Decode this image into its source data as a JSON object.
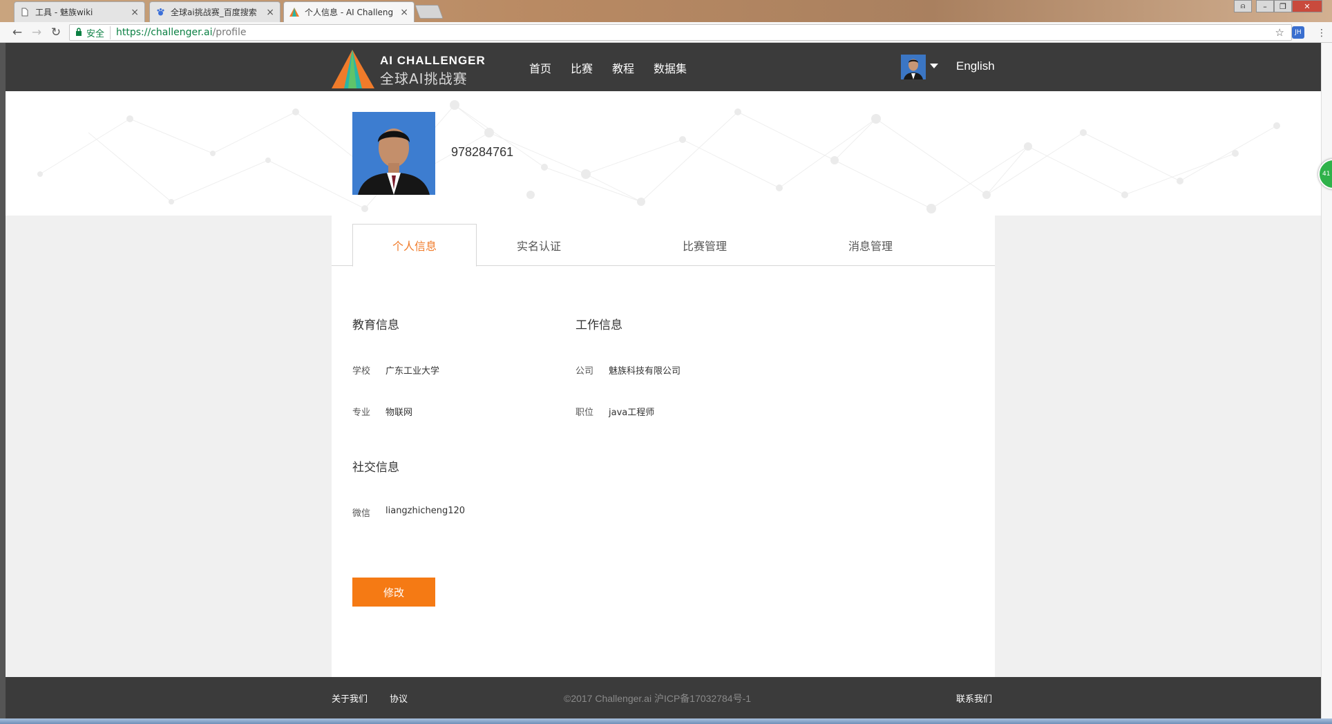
{
  "browser": {
    "tabs": [
      {
        "title": "工具 - 魅族wiki",
        "icon": "document-icon"
      },
      {
        "title": "全球ai挑战赛_百度搜索",
        "icon": "baidu-paw-icon"
      },
      {
        "title": "个人信息 - AI Challeng",
        "icon": "ai-challenger-logo-icon"
      }
    ],
    "secure_label": "安全",
    "url_host": "https://challenger.ai",
    "url_path": "/profile",
    "extension_label": "JH"
  },
  "header": {
    "logo_en": "AI CHALLENGER",
    "logo_cn": "全球AI挑战赛",
    "nav": [
      "首页",
      "比赛",
      "教程",
      "数据集"
    ],
    "language": "English"
  },
  "profile": {
    "user_id": "978284761"
  },
  "tabs": [
    "个人信息",
    "实名认证",
    "比赛管理",
    "消息管理"
  ],
  "education": {
    "title": "教育信息",
    "school_label": "学校",
    "school": "广东工业大学",
    "major_label": "专业",
    "major": "物联网"
  },
  "work": {
    "title": "工作信息",
    "company_label": "公司",
    "company": "魅族科技有限公司",
    "position_label": "职位",
    "position": "java工程师"
  },
  "social": {
    "title": "社交信息",
    "wechat_label": "微信",
    "wechat": "liangzhicheng120"
  },
  "edit_button": "修改",
  "footer": {
    "about": "关于我们",
    "agreement": "协议",
    "copyright": "©2017 Challenger.ai  沪ICP备17032784号-1",
    "contact": "联系我们"
  },
  "float_badge": "41",
  "colors": {
    "accent": "#f57a14",
    "header_bg": "#3b3b3b",
    "secure_green": "#0b8043"
  }
}
